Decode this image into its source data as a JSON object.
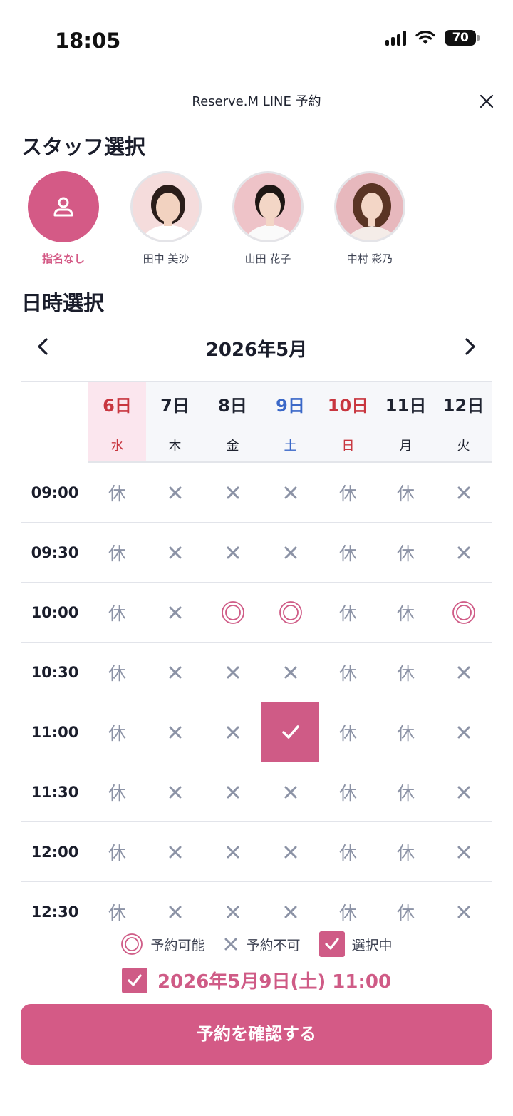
{
  "status_bar": {
    "time": "18:05",
    "battery": "70"
  },
  "header": {
    "title": "Reserve.M LINE 予約",
    "close_icon": "close-icon"
  },
  "staff_section": {
    "title": "スタッフ選択",
    "staff": [
      {
        "name": "指名なし",
        "selected": true,
        "icon": "person-icon"
      },
      {
        "name": "田中 美沙",
        "selected": false
      },
      {
        "name": "山田 花子",
        "selected": false
      },
      {
        "name": "中村 彩乃",
        "selected": false
      }
    ]
  },
  "datetime_section": {
    "title": "日時選択",
    "month": "2026年5月",
    "days": [
      {
        "day": "6日",
        "weekday": "水",
        "color": "red",
        "selected": true
      },
      {
        "day": "7日",
        "weekday": "木",
        "color": "dark",
        "selected": false
      },
      {
        "day": "8日",
        "weekday": "金",
        "color": "dark",
        "selected": false
      },
      {
        "day": "9日",
        "weekday": "土",
        "color": "blue",
        "selected": false
      },
      {
        "day": "10日",
        "weekday": "日",
        "color": "red",
        "selected": false
      },
      {
        "day": "11日",
        "weekday": "月",
        "color": "dark",
        "selected": false
      },
      {
        "day": "12日",
        "weekday": "火",
        "color": "dark",
        "selected": false
      }
    ],
    "rest_label": "休",
    "slots": [
      {
        "time": "09:00",
        "cells": [
          "rest",
          "x",
          "x",
          "x",
          "rest",
          "rest",
          "x"
        ]
      },
      {
        "time": "09:30",
        "cells": [
          "rest",
          "x",
          "x",
          "x",
          "rest",
          "rest",
          "x"
        ]
      },
      {
        "time": "10:00",
        "cells": [
          "rest",
          "x",
          "ok",
          "ok",
          "rest",
          "rest",
          "ok"
        ]
      },
      {
        "time": "10:30",
        "cells": [
          "rest",
          "x",
          "x",
          "x",
          "rest",
          "rest",
          "x"
        ]
      },
      {
        "time": "11:00",
        "cells": [
          "rest",
          "x",
          "x",
          "sel",
          "rest",
          "rest",
          "x"
        ]
      },
      {
        "time": "11:30",
        "cells": [
          "rest",
          "x",
          "x",
          "x",
          "rest",
          "rest",
          "x"
        ]
      },
      {
        "time": "12:00",
        "cells": [
          "rest",
          "x",
          "x",
          "x",
          "rest",
          "rest",
          "x"
        ]
      },
      {
        "time": "12:30",
        "cells": [
          "rest",
          "x",
          "x",
          "x",
          "rest",
          "rest",
          "x"
        ]
      }
    ]
  },
  "legend": {
    "available": "予約可能",
    "unavailable": "予約不可",
    "selected": "選択中"
  },
  "selected_datetime": "2026年5月9日(土) 11:00",
  "confirm_button": "予約を確認する",
  "colors": {
    "accent": "#d45a86",
    "sunday": "#c8363f",
    "saturday": "#3b68c8",
    "muted": "#8c93a6"
  }
}
